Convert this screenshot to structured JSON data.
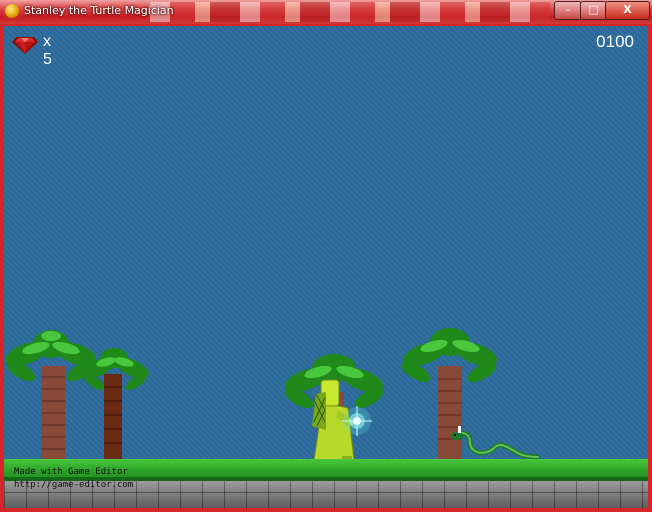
{
  "window": {
    "title": "Stanley the Turtle Magician",
    "minimize_label": "–",
    "maximize_label": "□",
    "close_label": "X"
  },
  "hud": {
    "lives_icon": "ruby-gem-icon",
    "lives_text": "x 5",
    "lives": 5,
    "score": "0100"
  },
  "footer": {
    "made_with": "Made with Game Editor",
    "url": "http://game-editor.com"
  },
  "colors": {
    "sky": "#2c6b9c",
    "grass": "#2ea52a",
    "window_frame": "#d7262a"
  }
}
